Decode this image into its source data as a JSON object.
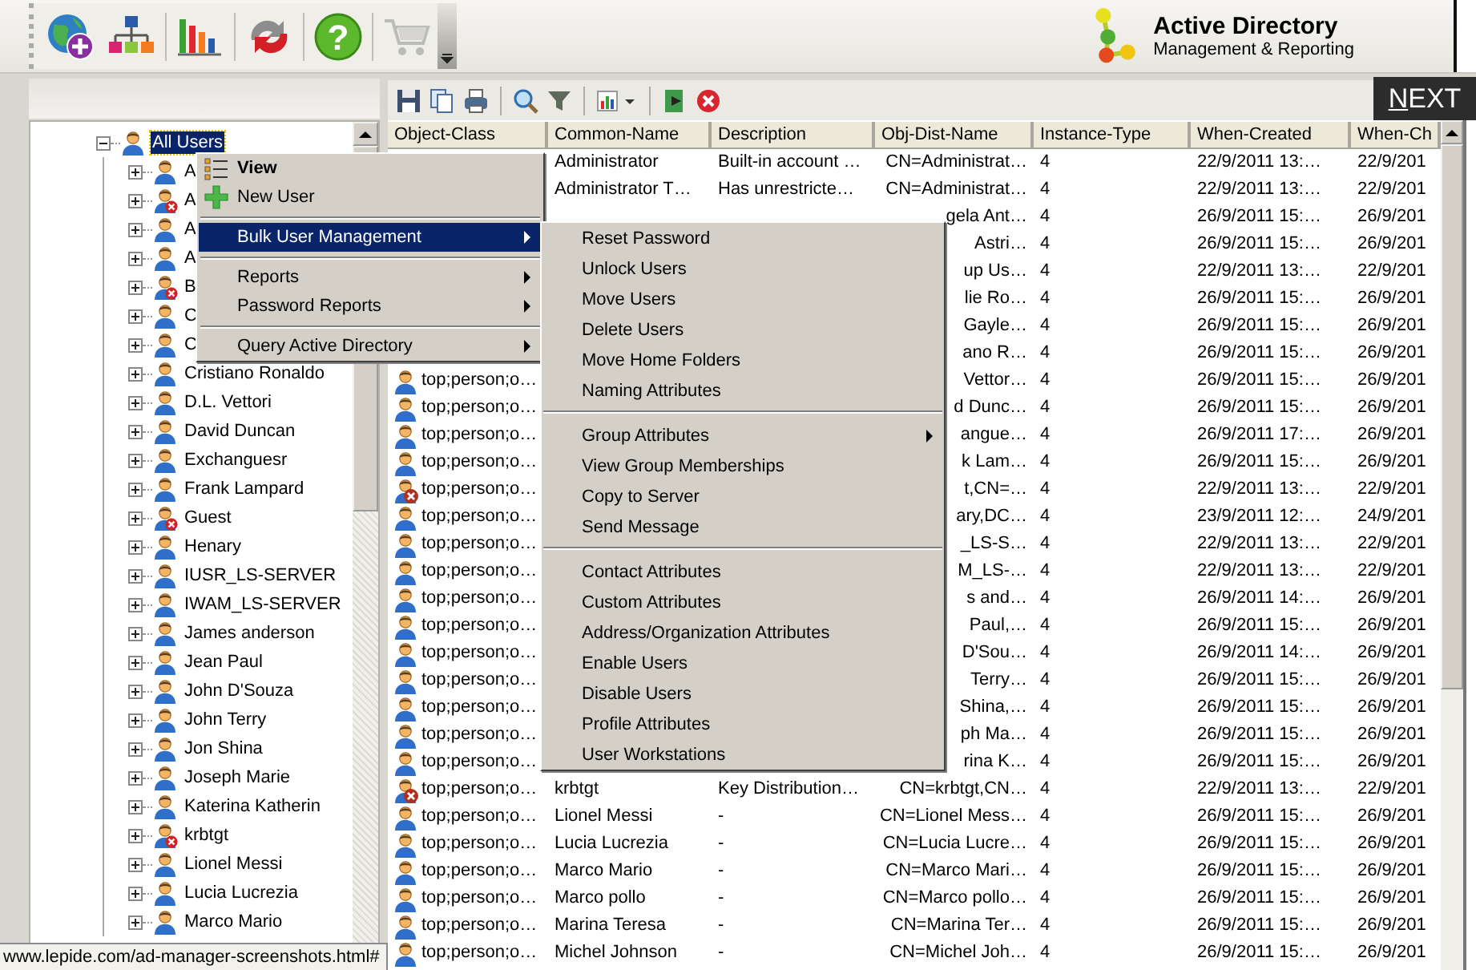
{
  "main_toolbar": [
    {
      "disabled": false
    },
    {
      "disabled": false
    },
    {
      "disabled": false
    },
    {
      "disabled": false
    },
    {
      "disabled": false,
      "glyph": "?"
    },
    {
      "disabled": true
    }
  ],
  "brand": {
    "title": "Active Directory",
    "subtitle": "Management & Reporting"
  },
  "next_button": {
    "label": "NEXT"
  },
  "tree": {
    "root": {
      "label": "All Users",
      "selected": true,
      "expanded": true,
      "children": [
        {
          "label": "A",
          "disabled": false,
          "expanded": false
        },
        {
          "label": "A",
          "disabled": true,
          "expanded": false
        },
        {
          "label": "A",
          "disabled": false,
          "expanded": false
        },
        {
          "label": "A",
          "disabled": false,
          "expanded": false
        },
        {
          "label": "B",
          "disabled": true,
          "expanded": false
        },
        {
          "label": "C",
          "disabled": false,
          "expanded": false
        },
        {
          "label": "C",
          "disabled": false,
          "expanded": false
        },
        {
          "label": "Cristiano Ronaldo",
          "disabled": false,
          "expanded": false
        },
        {
          "label": "D.L. Vettori",
          "disabled": false,
          "expanded": false
        },
        {
          "label": "David Duncan",
          "disabled": false,
          "expanded": false
        },
        {
          "label": "Exchanguesr",
          "disabled": false,
          "expanded": false
        },
        {
          "label": "Frank Lampard",
          "disabled": false,
          "expanded": false
        },
        {
          "label": "Guest",
          "disabled": true,
          "expanded": false
        },
        {
          "label": "Henary",
          "disabled": false,
          "expanded": false
        },
        {
          "label": "IUSR_LS-SERVER",
          "disabled": false,
          "expanded": false
        },
        {
          "label": "IWAM_LS-SERVER",
          "disabled": false,
          "expanded": false
        },
        {
          "label": "James anderson",
          "disabled": false,
          "expanded": false
        },
        {
          "label": "Jean Paul",
          "disabled": false,
          "expanded": false
        },
        {
          "label": "John D'Souza",
          "disabled": false,
          "expanded": false
        },
        {
          "label": "John Terry",
          "disabled": false,
          "expanded": false
        },
        {
          "label": "Jon Shina",
          "disabled": false,
          "expanded": false
        },
        {
          "label": "Joseph Marie",
          "disabled": false,
          "expanded": false
        },
        {
          "label": "Katerina Katherin",
          "disabled": false,
          "expanded": false
        },
        {
          "label": "krbtgt",
          "disabled": true,
          "expanded": false
        },
        {
          "label": "Lionel Messi",
          "disabled": false,
          "expanded": false
        },
        {
          "label": "Lucia Lucrezia",
          "disabled": false,
          "expanded": false
        },
        {
          "label": "Marco Mario",
          "disabled": false,
          "expanded": false
        }
      ]
    }
  },
  "table": {
    "columns": [
      "Object-Class",
      "Common-Name",
      "Description",
      "Obj-Dist-Name",
      "Instance-Type",
      "When-Created",
      "When-Ch"
    ],
    "rows": [
      {
        "common_name": "Administrator",
        "description": "Built-in account …",
        "obj_dist_name": "CN=Administrat…",
        "instance_type": "4",
        "when_created": "22/9/2011  13:…",
        "when_changed": "22/9/201"
      },
      {
        "common_name": "Administrator T…",
        "description": "Has unrestricte…",
        "obj_dist_name": "CN=Administrat…",
        "instance_type": "4",
        "when_created": "22/9/2011  13:…",
        "when_changed": "22/9/201"
      },
      {
        "obj_dist_name": "gela Ant…",
        "instance_type": "4",
        "when_created": "26/9/2011  15:…",
        "when_changed": "26/9/201"
      },
      {
        "obj_dist_name": "Astri…",
        "instance_type": "4",
        "when_created": "26/9/2011  15:…",
        "when_changed": "26/9/201"
      },
      {
        "obj_dist_name": "up Us…",
        "instance_type": "4",
        "when_created": "22/9/2011  13:…",
        "when_changed": "22/9/201"
      },
      {
        "obj_dist_name": "lie Ro…",
        "instance_type": "4",
        "when_created": "26/9/2011  15:…",
        "when_changed": "26/9/201"
      },
      {
        "obj_dist_name": "Gayle…",
        "instance_type": "4",
        "when_created": "26/9/2011  15:…",
        "when_changed": "26/9/201"
      },
      {
        "obj_dist_name": "ano R…",
        "instance_type": "4",
        "when_created": "26/9/2011  15:…",
        "when_changed": "26/9/201"
      },
      {
        "object_class": "top;person;o…",
        "obj_dist_name": "Vettor…",
        "instance_type": "4",
        "when_created": "26/9/2011  15:…",
        "when_changed": "26/9/201",
        "disabled": false
      },
      {
        "object_class": "top;person;o…",
        "obj_dist_name": "d Dunc…",
        "instance_type": "4",
        "when_created": "26/9/2011  15:…",
        "when_changed": "26/9/201",
        "disabled": false
      },
      {
        "object_class": "top;person;o…",
        "obj_dist_name": "angue…",
        "instance_type": "4",
        "when_created": "26/9/2011  17:…",
        "when_changed": "26/9/201",
        "disabled": false
      },
      {
        "object_class": "top;person;o…",
        "obj_dist_name": "k Lam…",
        "instance_type": "4",
        "when_created": "26/9/2011  15:…",
        "when_changed": "26/9/201",
        "disabled": false
      },
      {
        "object_class": "top;person;o…",
        "obj_dist_name": "t,CN=…",
        "instance_type": "4",
        "when_created": "22/9/2011  13:…",
        "when_changed": "22/9/201",
        "disabled": true
      },
      {
        "object_class": "top;person;o…",
        "obj_dist_name": "ary,DC…",
        "instance_type": "4",
        "when_created": "23/9/2011  12:…",
        "when_changed": "24/9/201",
        "disabled": false
      },
      {
        "object_class": "top;person;o…",
        "obj_dist_name": "_LS-S…",
        "instance_type": "4",
        "when_created": "22/9/2011  13:…",
        "when_changed": "22/9/201",
        "disabled": false
      },
      {
        "object_class": "top;person;o…",
        "obj_dist_name": "M_LS-…",
        "instance_type": "4",
        "when_created": "22/9/2011  13:…",
        "when_changed": "22/9/201",
        "disabled": false
      },
      {
        "object_class": "top;person;o…",
        "obj_dist_name": "s and…",
        "instance_type": "4",
        "when_created": "26/9/2011  14:…",
        "when_changed": "26/9/201",
        "disabled": false
      },
      {
        "object_class": "top;person;o…",
        "obj_dist_name": "Paul,…",
        "instance_type": "4",
        "when_created": "26/9/2011  15:…",
        "when_changed": "26/9/201",
        "disabled": false
      },
      {
        "object_class": "top;person;o…",
        "obj_dist_name": "D'Sou…",
        "instance_type": "4",
        "when_created": "26/9/2011  14:…",
        "when_changed": "26/9/201",
        "disabled": false
      },
      {
        "object_class": "top;person;o…",
        "obj_dist_name": "Terry…",
        "instance_type": "4",
        "when_created": "26/9/2011  15:…",
        "when_changed": "26/9/201",
        "disabled": false
      },
      {
        "object_class": "top;person;o…",
        "obj_dist_name": "Shina,…",
        "instance_type": "4",
        "when_created": "26/9/2011  15:…",
        "when_changed": "26/9/201",
        "disabled": false
      },
      {
        "object_class": "top;person;o…",
        "obj_dist_name": "ph Ma…",
        "instance_type": "4",
        "when_created": "26/9/2011  15:…",
        "when_changed": "26/9/201",
        "disabled": false
      },
      {
        "object_class": "top;person;o…",
        "obj_dist_name": "rina K…",
        "instance_type": "4",
        "when_created": "26/9/2011  15:…",
        "when_changed": "26/9/201",
        "disabled": false
      },
      {
        "object_class": "top;person;o…",
        "common_name": "krbtgt",
        "description": "Key Distribution…",
        "obj_dist_name": "CN=krbtgt,CN…",
        "instance_type": "4",
        "when_created": "22/9/2011  13:…",
        "when_changed": "22/9/201",
        "disabled": true
      },
      {
        "object_class": "top;person;o…",
        "common_name": "Lionel Messi",
        "description": "-",
        "obj_dist_name": "CN=Lionel Mess…",
        "instance_type": "4",
        "when_created": "26/9/2011  15:…",
        "when_changed": "26/9/201",
        "disabled": false
      },
      {
        "object_class": "top;person;o…",
        "common_name": "Lucia Lucrezia",
        "description": "-",
        "obj_dist_name": "CN=Lucia Lucre…",
        "instance_type": "4",
        "when_created": "26/9/2011  15:…",
        "when_changed": "26/9/201",
        "disabled": false
      },
      {
        "object_class": "top;person;o…",
        "common_name": "Marco Mario",
        "description": "-",
        "obj_dist_name": "CN=Marco Mari…",
        "instance_type": "4",
        "when_created": "26/9/2011  15:…",
        "when_changed": "26/9/201",
        "disabled": false
      },
      {
        "object_class": "top;person;o…",
        "common_name": "Marco pollo",
        "description": "-",
        "obj_dist_name": "CN=Marco pollo…",
        "instance_type": "4",
        "when_created": "26/9/2011  15:…",
        "when_changed": "26/9/201",
        "disabled": false
      },
      {
        "object_class": "top;person;o…",
        "common_name": "Marina Teresa",
        "description": "-",
        "obj_dist_name": "CN=Marina Ter…",
        "instance_type": "4",
        "when_created": "26/9/2011  15:…",
        "when_changed": "26/9/201",
        "disabled": false
      },
      {
        "object_class": "top;person;o…",
        "common_name": "Michel Johnson",
        "description": "-",
        "obj_dist_name": "CN=Michel Joh…",
        "instance_type": "4",
        "when_created": "26/9/2011  15:…",
        "when_changed": "26/9/201",
        "disabled": false
      }
    ]
  },
  "context_menu": {
    "items": [
      {
        "kind": "item",
        "label": "View",
        "default": true,
        "submenu": false,
        "selected": false
      },
      {
        "kind": "item",
        "label": "New User",
        "default": false,
        "submenu": false,
        "selected": false
      },
      {
        "kind": "separator"
      },
      {
        "kind": "item",
        "label": "Bulk User Management",
        "default": false,
        "submenu": true,
        "selected": true
      },
      {
        "kind": "separator"
      },
      {
        "kind": "item",
        "label": "Reports",
        "default": false,
        "submenu": true,
        "selected": false
      },
      {
        "kind": "item",
        "label": "Password Reports",
        "default": false,
        "submenu": true,
        "selected": false
      },
      {
        "kind": "separator"
      },
      {
        "kind": "item",
        "label": "Query Active Directory",
        "default": false,
        "submenu": true,
        "selected": false
      }
    ]
  },
  "submenu": {
    "items": [
      {
        "kind": "item",
        "label": "Reset Password",
        "submenu": false,
        "selected": false
      },
      {
        "kind": "item",
        "label": "Unlock Users",
        "submenu": false,
        "selected": false
      },
      {
        "kind": "item",
        "label": "Move Users",
        "submenu": false,
        "selected": false
      },
      {
        "kind": "item",
        "label": "Delete Users",
        "submenu": false,
        "selected": false
      },
      {
        "kind": "item",
        "label": "Move Home Folders",
        "submenu": false,
        "selected": false
      },
      {
        "kind": "item",
        "label": "Naming Attributes",
        "submenu": false,
        "selected": false
      },
      {
        "kind": "separator"
      },
      {
        "kind": "item",
        "label": "Group Attributes",
        "submenu": true,
        "selected": false
      },
      {
        "kind": "item",
        "label": "View Group Memberships",
        "submenu": false,
        "selected": false
      },
      {
        "kind": "item",
        "label": "Copy to Server",
        "submenu": false,
        "selected": false
      },
      {
        "kind": "item",
        "label": "Send Message",
        "submenu": false,
        "selected": false
      },
      {
        "kind": "separator"
      },
      {
        "kind": "item",
        "label": "Contact Attributes",
        "submenu": false,
        "selected": false
      },
      {
        "kind": "item",
        "label": "Custom Attributes",
        "submenu": false,
        "selected": false
      },
      {
        "kind": "item",
        "label": "Address/Organization Attributes",
        "submenu": false,
        "selected": false
      },
      {
        "kind": "item",
        "label": "Enable Users",
        "submenu": false,
        "selected": false
      },
      {
        "kind": "item",
        "label": "Disable Users",
        "submenu": false,
        "selected": false
      },
      {
        "kind": "item",
        "label": "Profile Attributes",
        "submenu": false,
        "selected": false
      },
      {
        "kind": "item",
        "label": "User Workstations",
        "submenu": false,
        "selected": false
      }
    ]
  },
  "status_url": "www.lepide.com/ad-manager-screenshots.html#"
}
